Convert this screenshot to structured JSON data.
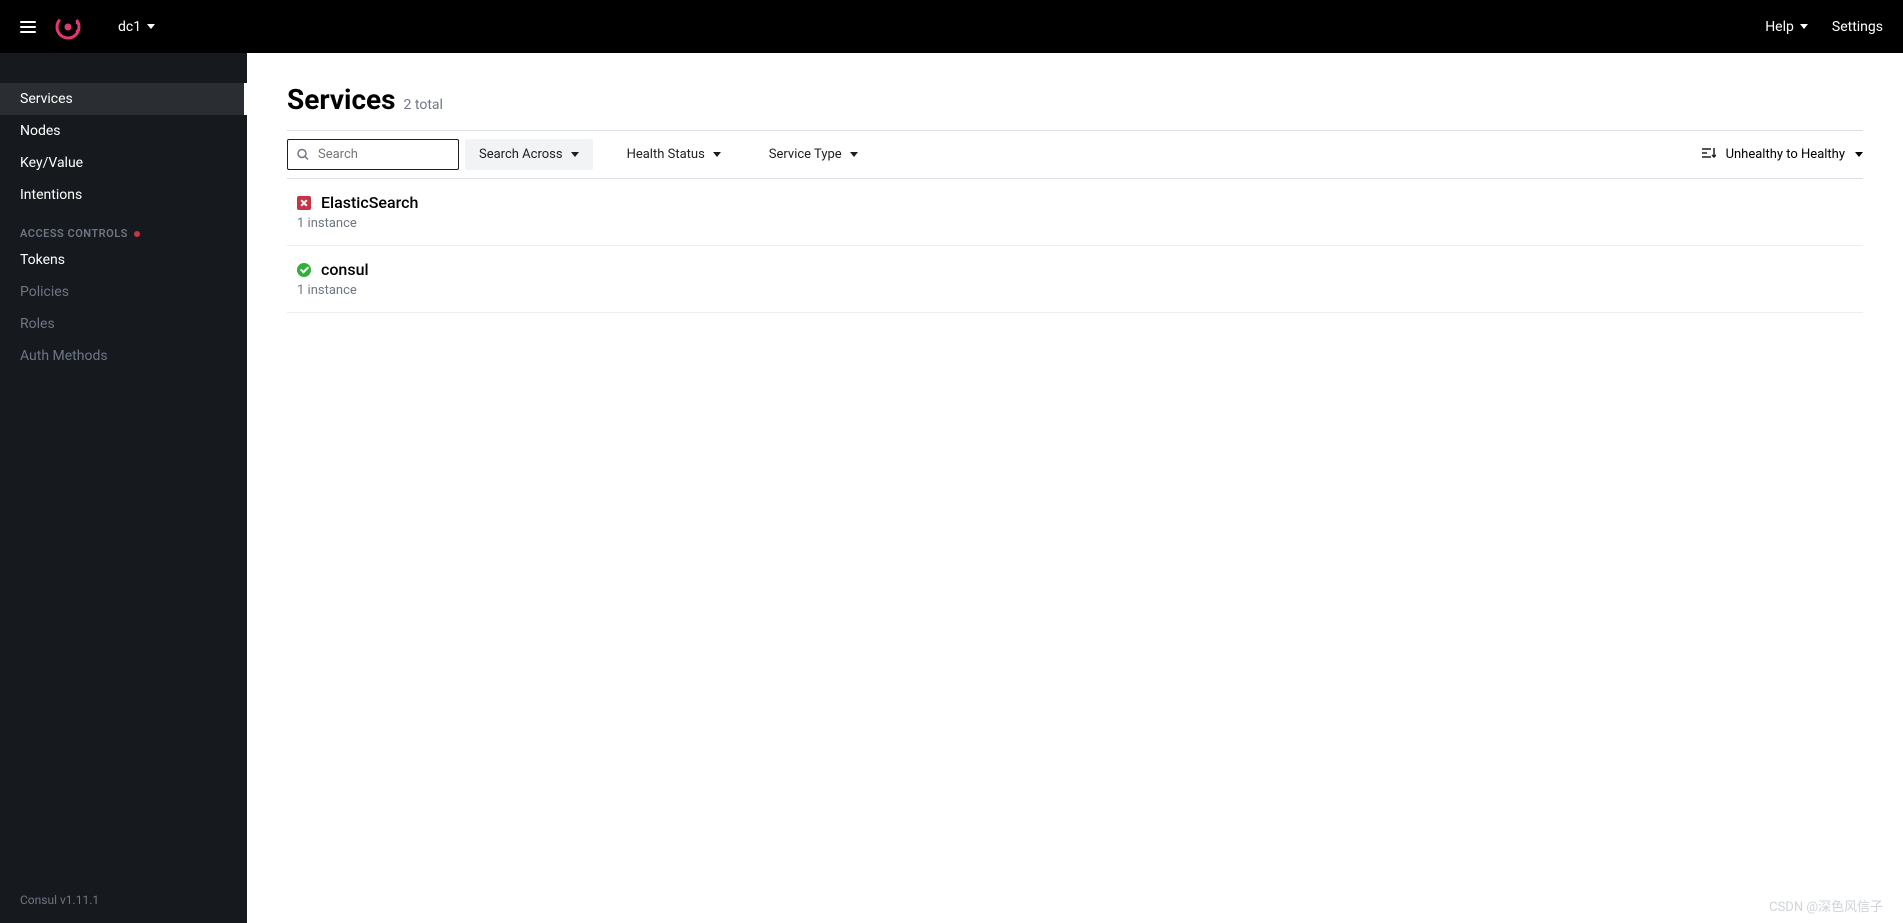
{
  "topbar": {
    "datacenter": "dc1",
    "help_label": "Help",
    "settings_label": "Settings"
  },
  "sidebar": {
    "items": [
      {
        "label": "Services",
        "active": true
      },
      {
        "label": "Nodes"
      },
      {
        "label": "Key/Value"
      },
      {
        "label": "Intentions"
      }
    ],
    "access_section": "ACCESS CONTROLS",
    "access_items": [
      {
        "label": "Tokens",
        "enabled": true
      },
      {
        "label": "Policies",
        "enabled": false
      },
      {
        "label": "Roles",
        "enabled": false
      },
      {
        "label": "Auth Methods",
        "enabled": false
      }
    ],
    "footer": "Consul v1.11.1"
  },
  "page": {
    "title": "Services",
    "subtitle": "2 total"
  },
  "filters": {
    "search_placeholder": "Search",
    "search_across": "Search Across",
    "health_status": "Health Status",
    "service_type": "Service Type",
    "sort": "Unhealthy to Healthy"
  },
  "services": [
    {
      "name": "ElasticSearch",
      "instances": "1 instance",
      "status": "critical"
    },
    {
      "name": "consul",
      "instances": "1 instance",
      "status": "passing"
    }
  ],
  "watermark": "CSDN @深色风信子"
}
